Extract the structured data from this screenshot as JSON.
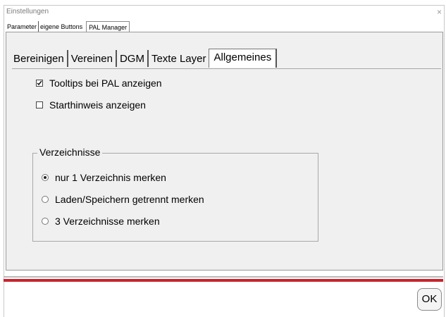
{
  "window": {
    "title": "Einstellungen",
    "close": "×"
  },
  "outer_tabs": [
    "Parameter",
    "eigene Buttons",
    "PAL Manager"
  ],
  "inner_tabs": [
    "Bereinigen",
    "Vereinen",
    "DGM",
    "Texte Layer",
    "Allgemeines"
  ],
  "options": {
    "tooltips": {
      "label": "Tooltips bei PAL anzeigen",
      "checked": true,
      "mark": "☑"
    },
    "starthinweis": {
      "label": "Starthinweis anzeigen",
      "checked": false
    }
  },
  "verzeichnisse": {
    "label": "Verzeichnisse",
    "radios": [
      {
        "label": "nur 1 Verzeichnis merken",
        "selected": true
      },
      {
        "label": "Laden/Speichern getrennt merken",
        "selected": false
      },
      {
        "label": "3 Verzeichnisse merken",
        "selected": false
      }
    ]
  },
  "footer": {
    "ok_label": "OK",
    "accent": "#c7242c"
  }
}
